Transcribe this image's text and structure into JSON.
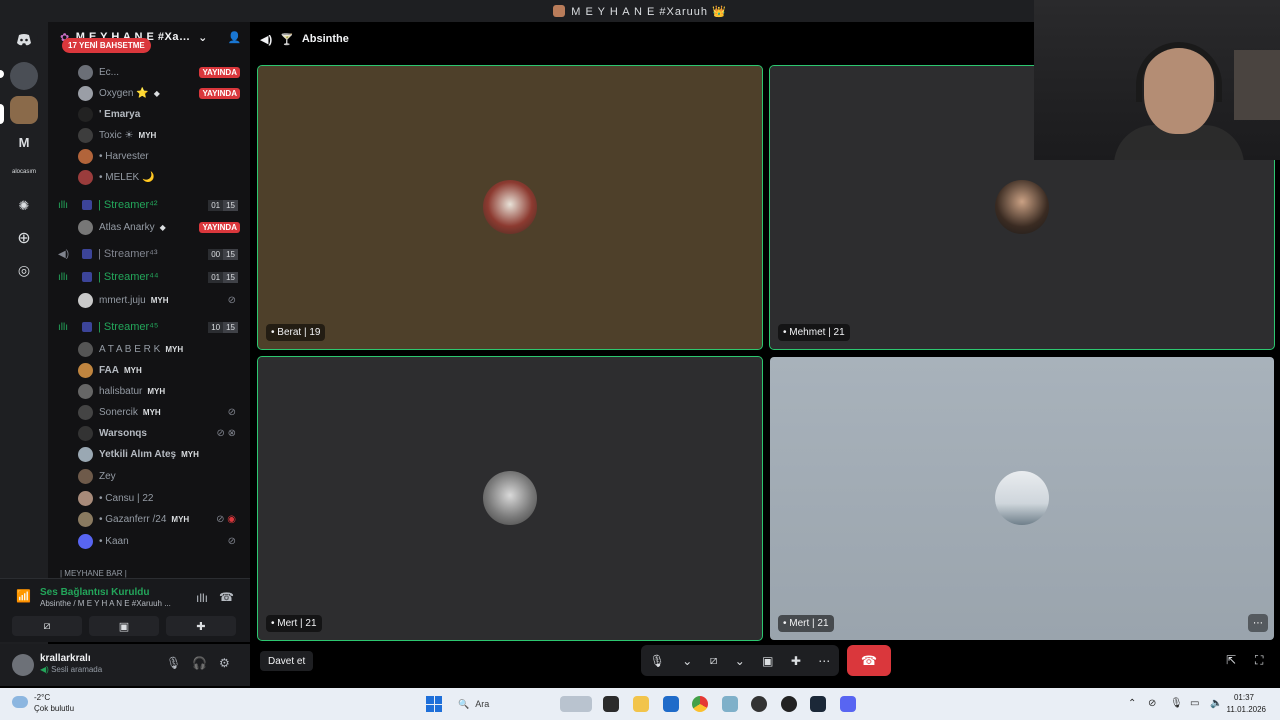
{
  "window": {
    "title": "M E Y H A N E #Xaruuh 👑"
  },
  "server": {
    "name": "M E Y H A N E #Xaruuh ..."
  },
  "new_badge": "17 YENİ BAHSETME",
  "members_top": [
    {
      "name": "Ec...",
      "live": "YAYINDA"
    },
    {
      "name": "Oxygen ⭐",
      "badge": "MYH",
      "live": "YAYINDA"
    },
    {
      "name": "' Emarya"
    },
    {
      "name": "Toxic ☀",
      "badge": "MYH"
    },
    {
      "name": "• Harvester"
    },
    {
      "name": "• MELEK 🌙"
    }
  ],
  "channels": [
    {
      "name": "| Streamer⁴²",
      "counts": [
        "01",
        "15"
      ],
      "active": true
    },
    {
      "name": "| Streamer⁴³",
      "counts": [
        "00",
        "15"
      ],
      "active": false
    },
    {
      "name": "| Streamer⁴⁴",
      "counts": [
        "01",
        "15"
      ],
      "active": true
    },
    {
      "name": "| Streamer⁴⁵",
      "counts": [
        "10",
        "15"
      ],
      "active": true
    }
  ],
  "member_atlas": {
    "name": "Atlas Anarky",
    "live": "YAYINDA"
  },
  "member_mmert": {
    "name": "mmert.juju",
    "badge": "MYH"
  },
  "members_s45": [
    {
      "name": "A T A B E R K",
      "badge": "MYH"
    },
    {
      "name": "FAA",
      "badge": "MYH"
    },
    {
      "name": "halisbatur",
      "badge": "MYH"
    },
    {
      "name": "Sonercik",
      "badge": "MYH"
    },
    {
      "name": "Warsonqs"
    },
    {
      "name": "Yetkili Alım Ateş",
      "badge": "MYH"
    },
    {
      "name": "Zey"
    },
    {
      "name": "• Cansu | 22"
    },
    {
      "name": "• Gazanferr /24",
      "badge": "MYH"
    },
    {
      "name": "• Kaan"
    }
  ],
  "category_cut": "| MEYHANE BAR |",
  "voice_panel": {
    "status": "Ses Bağlantısı Kuruldu",
    "channel": "Absinthe / M E Y H A N E #Xaruuh ..."
  },
  "user": {
    "name": "krallarkralı",
    "status": "Sesli aramada"
  },
  "stage": {
    "channel": "Absinthe",
    "tiles": [
      {
        "label": "• Berat | 19"
      },
      {
        "label": "• Mehmet | 21"
      },
      {
        "label": "• Mert | 21"
      },
      {
        "label": "• Mert | 21"
      }
    ],
    "invite_label": "Davet et"
  },
  "taskbar": {
    "temp": "-2°C",
    "weather": "Çok bulutlu",
    "search_placeholder": "Ara",
    "time": "01:37",
    "date": "11.01.2026"
  },
  "colors": {
    "accent": "#5865f2",
    "speaking": "#2dc770",
    "live": "#da373c",
    "tile_brown": "#4e402a",
    "tile_gray": "#2d2d2f",
    "tile_light": "#a8b2bb"
  }
}
